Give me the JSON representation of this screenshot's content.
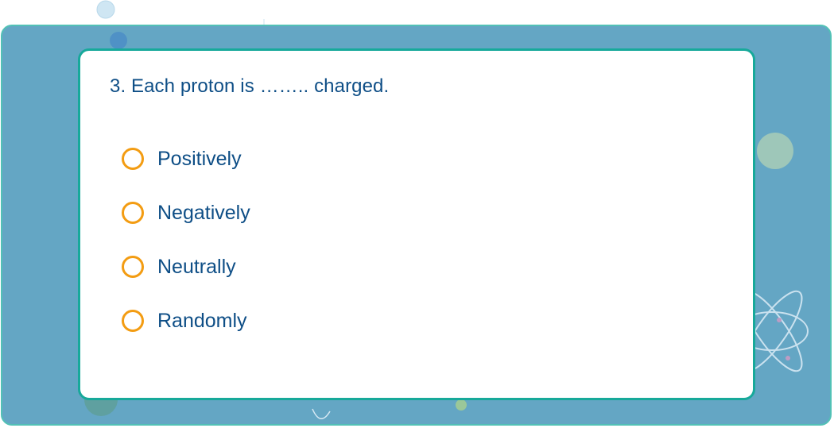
{
  "quiz": {
    "question": "3. Each proton is …….. charged.",
    "options": [
      {
        "label": "Positively",
        "selected": false
      },
      {
        "label": "Negatively",
        "selected": false
      },
      {
        "label": "Neutrally",
        "selected": false
      },
      {
        "label": "Randomly",
        "selected": false
      }
    ]
  },
  "colors": {
    "panel_background": "#64a6c4",
    "panel_border": "#52c1b6",
    "card_border": "#17a99a",
    "text": "#0e4e86",
    "radio_border": "#f39c12"
  },
  "decorations": [
    "bubble-icon",
    "molecule-icon",
    "atom-icon"
  ]
}
